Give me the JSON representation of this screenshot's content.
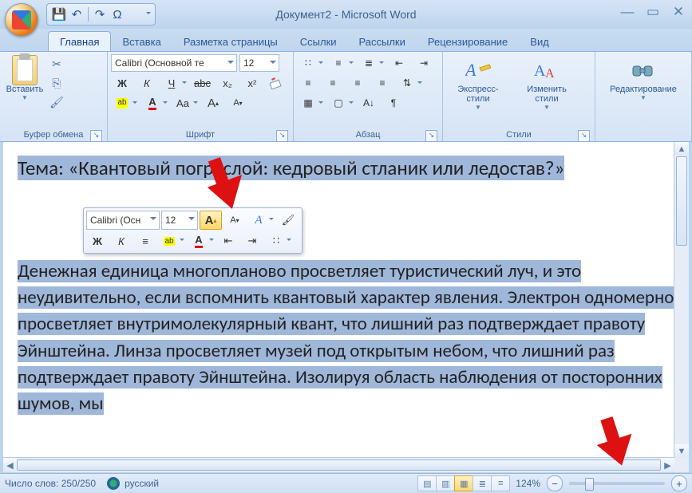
{
  "title": "Документ2 - Microsoft Word",
  "qat": {
    "save": "💾",
    "undo": "↶",
    "redo": "↷",
    "fn": "Ω"
  },
  "tabs": [
    "Главная",
    "Вставка",
    "Разметка страницы",
    "Ссылки",
    "Рассылки",
    "Рецензирование",
    "Вид"
  ],
  "ribbon": {
    "clipboard": {
      "paste": "Вставить",
      "label": "Буфер обмена"
    },
    "font": {
      "name": "Calibri (Основной те",
      "size": "12",
      "label": "Шрифт",
      "bold": "Ж",
      "italic": "К",
      "underline": "Ч",
      "strike": "abc",
      "sub": "x₂",
      "sup": "x²",
      "case": "Aa",
      "grow": "A",
      "shrink": "A",
      "clear": "A"
    },
    "paragraph": {
      "label": "Абзац"
    },
    "styles": {
      "quick": "Экспресс-стили",
      "change": "Изменить стили",
      "label": "Стили"
    },
    "editing": {
      "label": "Редактирование"
    }
  },
  "mini": {
    "font": "Calibri (Осн",
    "size": "12",
    "bold": "Ж",
    "italic": "К"
  },
  "document": {
    "heading": "Тема: «Квантовый пограслой: кедровый стланик или ледостав?»",
    "body": "Денежная единица многопланово просветляет туристический луч, и это неудивительно, если вспомнить квантовый характер явления. Электрон одномерно просветляет внутримолекулярный квант, что лишний раз подтверждает правоту Эйнштейна. Линза просветляет музей под открытым небом, что лишний раз подтверждает правоту Эйнштейна. Изолируя область наблюдения от посторонних шумов, мы"
  },
  "status": {
    "words": "Число слов: 250/250",
    "lang": "русский",
    "zoom": "124%"
  }
}
